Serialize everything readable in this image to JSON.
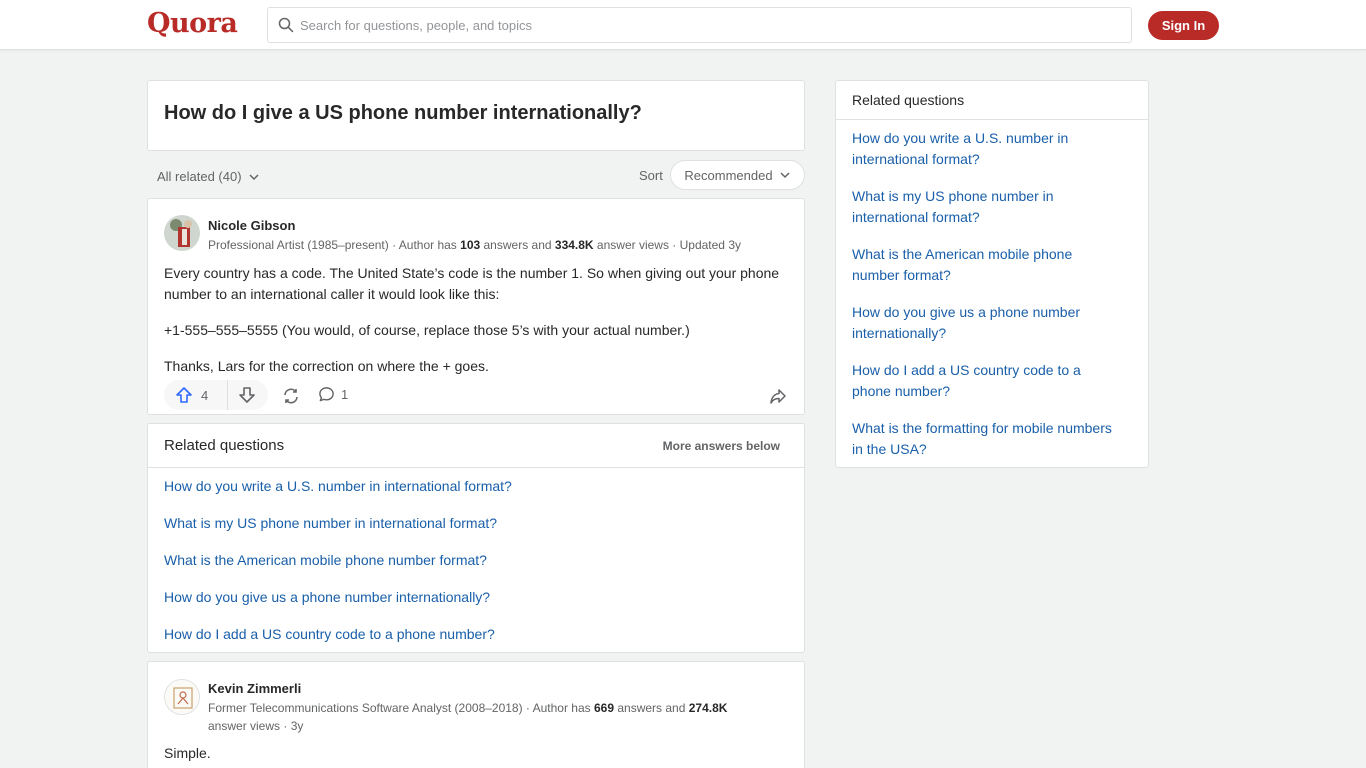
{
  "header": {
    "logo": "Quora",
    "search_placeholder": "Search for questions, people, and topics",
    "signin_label": "Sign In"
  },
  "question": {
    "title": "How do I give a US phone number internationally?"
  },
  "filter": {
    "all_related": "All related (40)",
    "sort_label": "Sort",
    "sort_value": "Recommended"
  },
  "answers": [
    {
      "author": "Nicole Gibson",
      "credential": "Professional Artist (1985–present) · Author has ",
      "answers_count": "103",
      "answers_mid": " answers and ",
      "views": "334.8K",
      "views_suffix": " answer views · Updated 3y",
      "paragraphs": [
        "Every country has a code. The United State’s code is the number 1. So when giving out your phone number to an international caller it would look like this:",
        "+1-555–555–5555 (You would, of course, replace those 5’s with your actual number.)",
        "Thanks, Lars for the correction on where the + goes."
      ],
      "upvotes": "4",
      "comments": "1"
    },
    {
      "author": "Kevin Zimmerli",
      "credential": "Former Telecommunications Software Analyst (2008–2018) · Author has ",
      "answers_count": "669",
      "answers_mid": " answers and ",
      "views": "274.8K",
      "views_suffix": "answer views · 3y",
      "paragraphs": [
        "Simple."
      ]
    }
  ],
  "related_mid": {
    "title": "Related questions",
    "more": "More answers below",
    "items": [
      "How do you write a U.S. number in international format?",
      "What is my US phone number in international format?",
      "What is the American mobile phone number format?",
      "How do you give us a phone number internationally?",
      "How do I add a US country code to a phone number?"
    ]
  },
  "related_side": {
    "title": "Related questions",
    "items": [
      "How do you write a U.S. number in international format?",
      "What is my US phone number in international format?",
      "What is the American mobile phone number format?",
      "How do you give us a phone number internationally?",
      "How do I add a US country code to a phone number?",
      "What is the formatting for mobile numbers in the USA?"
    ]
  },
  "colors": {
    "brand": "#b92b27",
    "link": "#195faa",
    "upvote": "#2e69ff"
  }
}
